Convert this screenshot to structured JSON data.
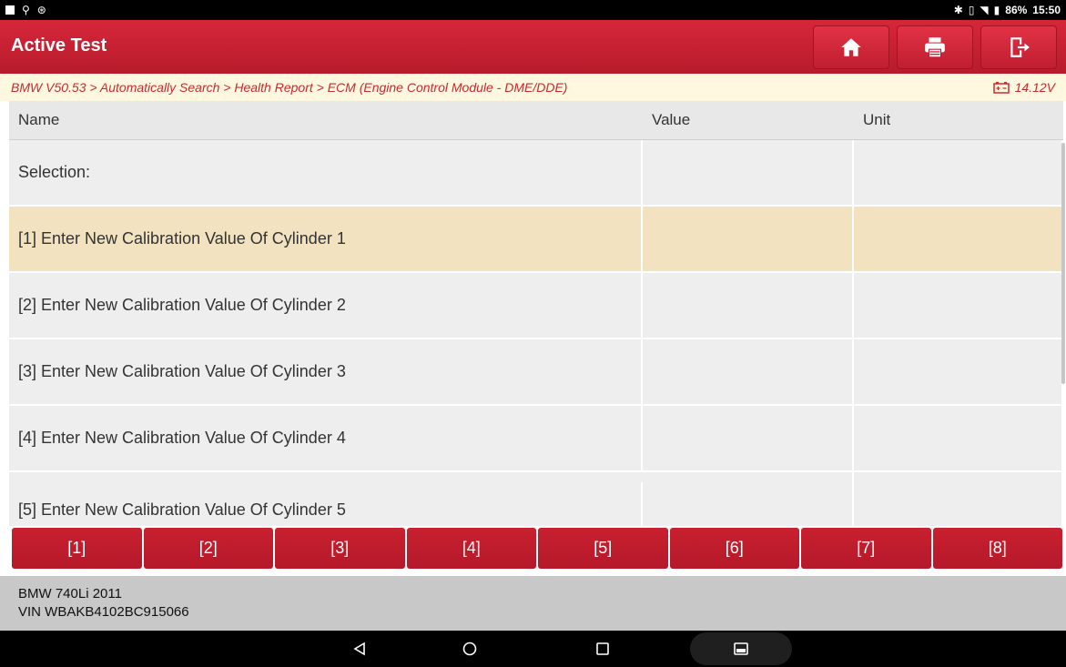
{
  "statusbar": {
    "battery": "86%",
    "time": "15:50"
  },
  "appbar": {
    "title": "Active Test",
    "icons": [
      "home-icon",
      "print-icon",
      "exit-icon"
    ]
  },
  "breadcrumb": {
    "path": "BMW V50.53 > Automatically Search > Health Report > ECM (Engine Control Module - DME/DDE)",
    "voltage": "14.12V"
  },
  "table": {
    "columns": {
      "name": "Name",
      "value": "Value",
      "unit": "Unit"
    },
    "rows": [
      {
        "name": "Selection:",
        "value": "",
        "unit": ""
      },
      {
        "name": "[1] Enter New Calibration Value Of Cylinder 1",
        "value": "",
        "unit": "",
        "selected": true
      },
      {
        "name": "[2] Enter New Calibration Value Of Cylinder 2",
        "value": "",
        "unit": ""
      },
      {
        "name": "[3] Enter New Calibration Value Of Cylinder 3",
        "value": "",
        "unit": ""
      },
      {
        "name": "[4] Enter New Calibration Value Of Cylinder 4",
        "value": "",
        "unit": ""
      },
      {
        "name": "[5] Enter New Calibration Value Of Cylinder 5",
        "value": "",
        "unit": ""
      }
    ]
  },
  "keys": [
    "[1]",
    "[2]",
    "[3]",
    "[4]",
    "[5]",
    "[6]",
    "[7]",
    "[8]"
  ],
  "footer": {
    "vehicle": "BMW 740Li 2011",
    "vin": "VIN WBAKB4102BC915066"
  },
  "colors": {
    "accent": "#c8202f",
    "selected_row": "#f2e2c0",
    "breadcrumb_bg": "#fff8e0"
  }
}
